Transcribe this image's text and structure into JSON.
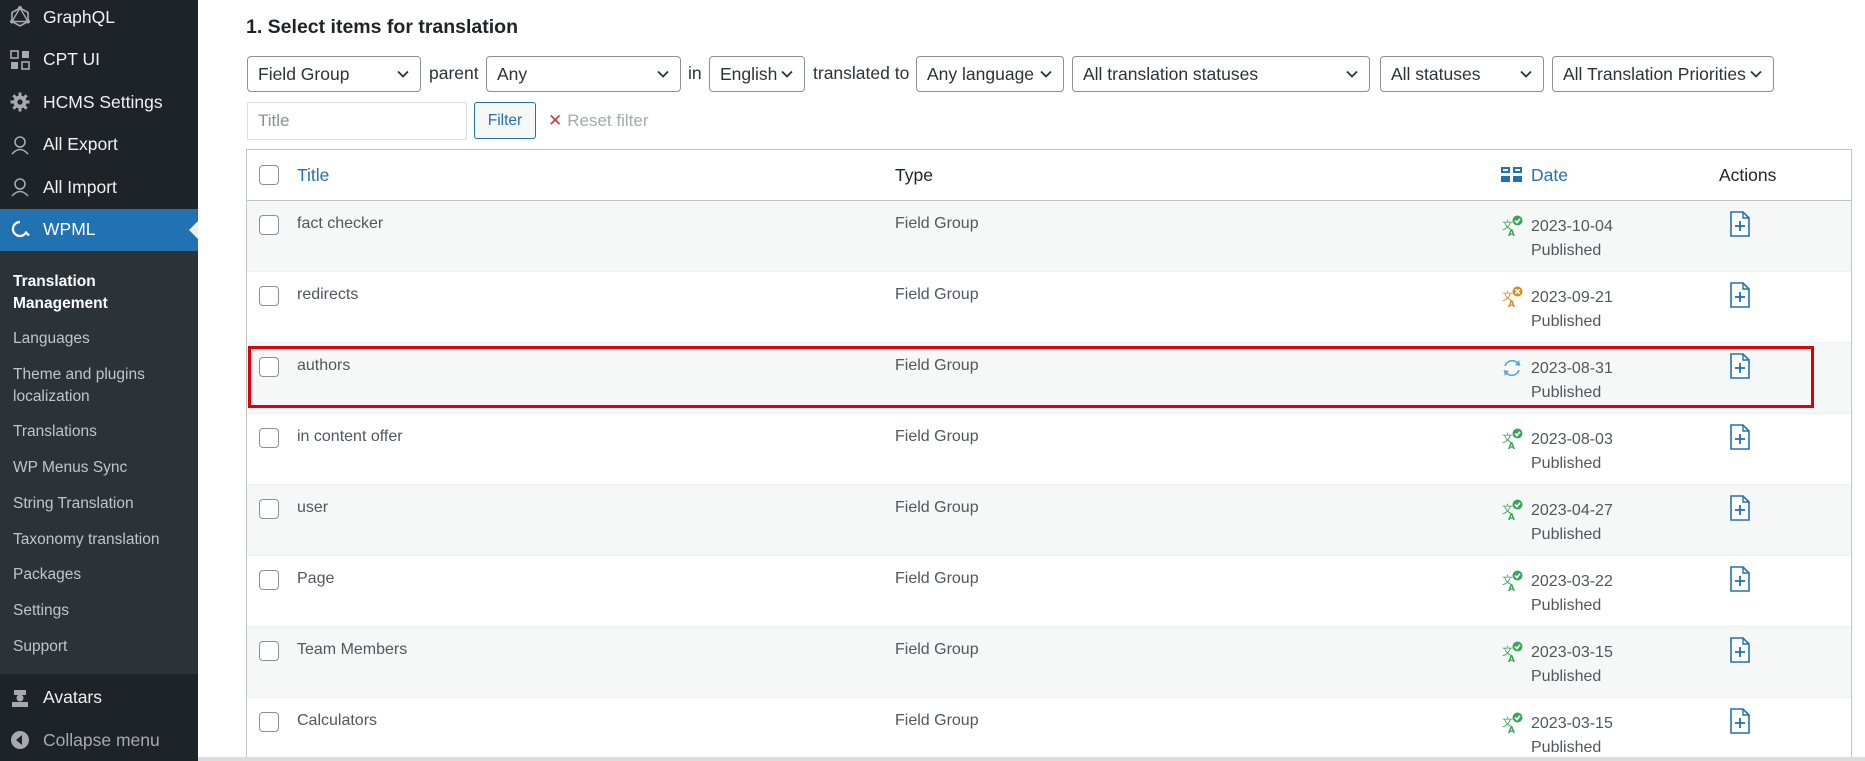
{
  "sidebar": {
    "items_top": [
      {
        "label": "GraphQL",
        "icon": "graphql-icon"
      },
      {
        "label": "CPT UI",
        "icon": "grid-icon"
      },
      {
        "label": "HCMS Settings",
        "icon": "gear-icon"
      },
      {
        "label": "All Export",
        "icon": "export-icon"
      },
      {
        "label": "All Import",
        "icon": "import-icon"
      }
    ],
    "active": {
      "label": "WPML",
      "icon": "wpml-icon"
    },
    "submenu": [
      "Translation Management",
      "Languages",
      "Theme and plugins localization",
      "Translations",
      "WP Menus Sync",
      "String Translation",
      "Taxonomy translation",
      "Packages",
      "Settings",
      "Support"
    ],
    "items_bottom": [
      {
        "label": "Avatars",
        "icon": "avatar-icon"
      },
      {
        "label": "Collapse menu",
        "icon": "collapse-icon"
      }
    ]
  },
  "main": {
    "heading": "1. Select items for translation",
    "filters": {
      "type": "Field Group",
      "parent_label": "parent",
      "parent": "Any",
      "in_label": "in",
      "language": "English",
      "translated_to_label": "translated to",
      "target_language": "Any language",
      "translation_status": "All translation statuses",
      "status": "All statuses",
      "priority": "All Translation Priorities",
      "title_placeholder": "Title",
      "filter_button": "Filter",
      "reset_label": "Reset filter"
    },
    "table": {
      "headers": {
        "title": "Title",
        "type": "Type",
        "date": "Date",
        "actions": "Actions"
      },
      "rows": [
        {
          "title": "fact checker",
          "type": "Field Group",
          "date": "2023-10-04",
          "status": "Published",
          "translation": "translated"
        },
        {
          "title": "redirects",
          "type": "Field Group",
          "date": "2023-09-21",
          "status": "Published",
          "translation": "needs-update"
        },
        {
          "title": "authors",
          "type": "Field Group",
          "date": "2023-08-31",
          "status": "Published",
          "translation": "in-progress"
        },
        {
          "title": "in content offer",
          "type": "Field Group",
          "date": "2023-08-03",
          "status": "Published",
          "translation": "translated"
        },
        {
          "title": "user",
          "type": "Field Group",
          "date": "2023-04-27",
          "status": "Published",
          "translation": "translated"
        },
        {
          "title": "Page",
          "type": "Field Group",
          "date": "2023-03-22",
          "status": "Published",
          "translation": "translated"
        },
        {
          "title": "Team Members",
          "type": "Field Group",
          "date": "2023-03-15",
          "status": "Published",
          "translation": "translated"
        },
        {
          "title": "Calculators",
          "type": "Field Group",
          "date": "2023-03-15",
          "status": "Published",
          "translation": "translated"
        }
      ]
    }
  },
  "colors": {
    "sidebar_bg": "#1d2327",
    "active_bg": "#2271b1",
    "link": "#2271b1",
    "translated": "#3ba55c",
    "needs_update": "#e08a1e",
    "in_progress": "#5aa7d8",
    "highlight": "#e0000a"
  }
}
